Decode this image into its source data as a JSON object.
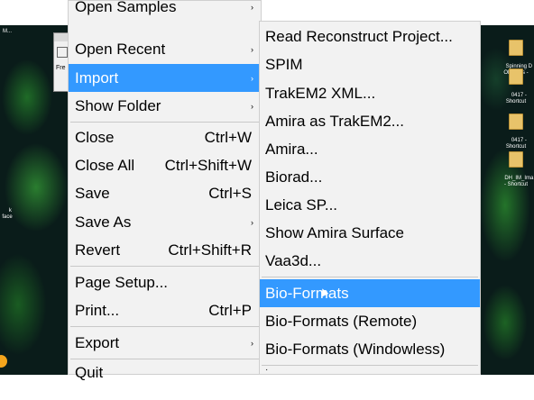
{
  "desktop": {
    "left_icons": [
      {
        "label": "M..."
      },
      {
        "label": "k\nface"
      }
    ],
    "right_icons": [
      {
        "label": "Spinning D\nOlympus -"
      },
      {
        "label": "0417 -\nShortcut"
      },
      {
        "label": "0417 -\nShortcut"
      },
      {
        "label": "DH_IM_Ima\n- Shortcut"
      }
    ],
    "back_window_fragment": "Fre"
  },
  "main_menu": {
    "items": [
      {
        "label": "Open Samples",
        "shortcut": "",
        "submenu": true
      },
      {
        "label": "Open Recent",
        "shortcut": "",
        "submenu": true
      },
      {
        "label": "Import",
        "shortcut": "",
        "submenu": true
      },
      {
        "label": "Show Folder",
        "shortcut": "",
        "submenu": true
      },
      {
        "label": "Close",
        "shortcut": "Ctrl+W",
        "submenu": false
      },
      {
        "label": "Close All",
        "shortcut": "Ctrl+Shift+W",
        "submenu": false
      },
      {
        "label": "Save",
        "shortcut": "Ctrl+S",
        "submenu": false
      },
      {
        "label": "Save As",
        "shortcut": "",
        "submenu": true
      },
      {
        "label": "Revert",
        "shortcut": "Ctrl+Shift+R",
        "submenu": false
      },
      {
        "label": "Page Setup...",
        "shortcut": "",
        "submenu": false
      },
      {
        "label": "Print...",
        "shortcut": "Ctrl+P",
        "submenu": false
      },
      {
        "label": "Export",
        "shortcut": "",
        "submenu": true
      },
      {
        "label": "Quit",
        "shortcut": "",
        "submenu": false
      }
    ],
    "submenu_arrow": "›"
  },
  "import_submenu": {
    "items": [
      {
        "label": "Read Reconstruct Project..."
      },
      {
        "label": "SPIM"
      },
      {
        "label": "TrakEM2 XML..."
      },
      {
        "label": "Amira as TrakEM2..."
      },
      {
        "label": "Amira..."
      },
      {
        "label": "Biorad..."
      },
      {
        "label": "Leica SP..."
      },
      {
        "label": "Show Amira Surface"
      },
      {
        "label": "Vaa3d..."
      },
      {
        "label": "Bio-Formats"
      },
      {
        "label": "Bio-Formats (Remote)"
      },
      {
        "label": "Bio-Formats (Windowless)"
      },
      {
        "label": "·"
      }
    ]
  },
  "colors": {
    "highlight": "#3399ff",
    "menu_bg": "#f2f2f2"
  }
}
